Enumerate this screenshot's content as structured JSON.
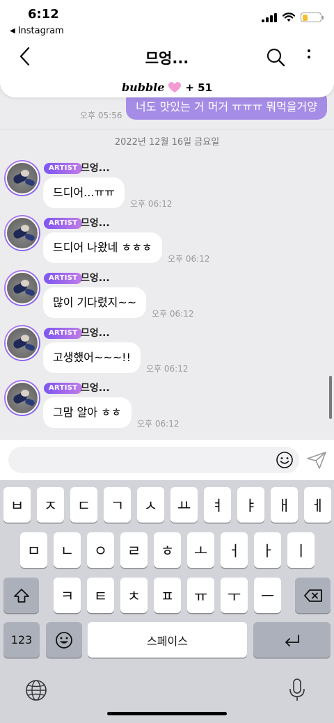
{
  "status_bar": {
    "time": "6:12",
    "back_app": "Instagram"
  },
  "header": {
    "title": "므엉...",
    "bubble_logo": "bubble",
    "bubble_count": "+ 51"
  },
  "previous_message": {
    "text": "너도 맛있는 거 머거 ㅠㅠㅠ 뭐먹을거양",
    "time": "오후 05:56"
  },
  "date_divider": "2022년 12월 16일 금요일",
  "badge_label": "ARTIST",
  "messages": [
    {
      "sender": "므엉...",
      "text": "드디어...ㅠㅠ",
      "time": "오후 06:12"
    },
    {
      "sender": "므엉...",
      "text": "드디어 나왔네 ㅎㅎㅎ",
      "time": "오후 06:12"
    },
    {
      "sender": "므엉...",
      "text": "많이 기다렸지~~",
      "time": "오후 06:12"
    },
    {
      "sender": "므엉...",
      "text": "고생했어~~~!!",
      "time": "오후 06:12"
    },
    {
      "sender": "므엉...",
      "text": "그맘 알아 ㅎㅎ",
      "time": "오후 06:12"
    }
  ],
  "composer": {
    "placeholder": ""
  },
  "keyboard": {
    "row1": [
      "ㅂ",
      "ㅈ",
      "ㄷ",
      "ㄱ",
      "ㅅ",
      "ㅛ",
      "ㅕ",
      "ㅑ",
      "ㅐ",
      "ㅔ"
    ],
    "row2": [
      "ㅁ",
      "ㄴ",
      "ㅇ",
      "ㄹ",
      "ㅎ",
      "ㅗ",
      "ㅓ",
      "ㅏ",
      "ㅣ"
    ],
    "row3": [
      "ㅋ",
      "ㅌ",
      "ㅊ",
      "ㅍ",
      "ㅠ",
      "ㅜ",
      "ㅡ"
    ],
    "numbers_key": "123",
    "space_key": "스페이스"
  },
  "colors": {
    "accent_purple": "#a58ce6",
    "artist_badge_start": "#7d55f0",
    "artist_badge_end": "#c07ce8",
    "battery_fill": "#f2c02c",
    "keyboard_bg": "#d2d4da"
  },
  "icons": {
    "back": "chevron-left-icon",
    "search": "search-icon",
    "more": "more-vertical-icon",
    "heart": "heart-icon",
    "emoji": "smiley-icon",
    "send": "paper-plane-icon",
    "shift": "shift-icon",
    "backspace": "backspace-icon",
    "return": "return-icon",
    "globe": "globe-icon",
    "mic": "mic-icon"
  },
  "battery_level": 0.28
}
